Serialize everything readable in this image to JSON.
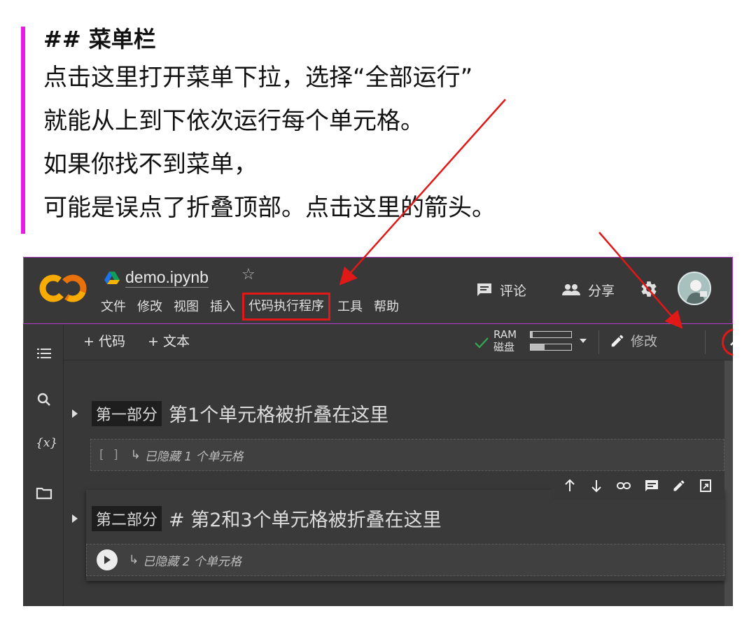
{
  "annotation": {
    "heading": "## 菜单栏",
    "lines": [
      "点击这里打开菜单下拉，选择“全部运行”",
      "就能从上到下依次运行每个单元格。",
      "如果你找不到菜单，",
      "可能是误点了折叠顶部。点击这里的箭头。"
    ],
    "accent_color": "#e81ce4",
    "arrow_color": "#e01818"
  },
  "app": {
    "logo_text": "CO",
    "filename": "demo.ipynb",
    "menu": [
      "文件",
      "修改",
      "视图",
      "插入",
      "代码执行程序",
      "工具",
      "帮助"
    ],
    "comment_label": "评论",
    "share_label": "分享"
  },
  "toolbar": {
    "add_code": "+ 代码",
    "add_text": "+ 文本",
    "ram_label": "RAM",
    "disk_label": "磁盘",
    "ram_usage": 0.05,
    "disk_usage": 0.35,
    "edit_label": "修改"
  },
  "sidebar": {
    "icons": [
      "toc-icon",
      "search-icon",
      "variables-icon",
      "folder-icon"
    ],
    "variables_text": "{x}"
  },
  "notebook": {
    "sections": [
      {
        "tag": "第一部分",
        "title": "第1个单元格被折叠在这里",
        "hidden_text": "已隐藏 1 个单元格",
        "bracket": "[ ]"
      },
      {
        "tag": "第二部分",
        "title": "# 第2和3个单元格被折叠在这里",
        "hidden_text": "已隐藏 2 个单元格"
      }
    ]
  },
  "colors": {
    "panel": "#383838",
    "highlight_box": "#e01818",
    "header_outline": "#b340c8"
  }
}
